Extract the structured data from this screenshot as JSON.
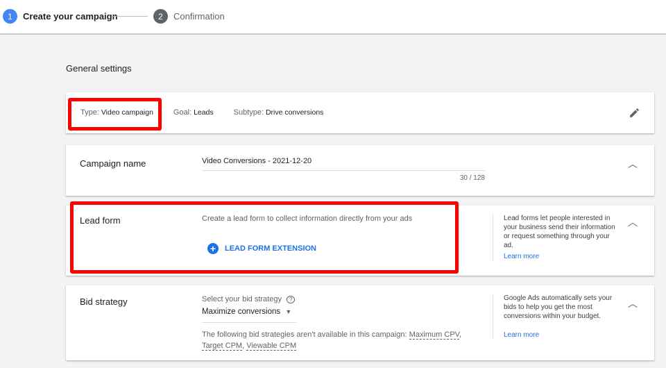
{
  "stepper": {
    "steps": [
      {
        "num": "1",
        "label": "Create your campaign",
        "active": true
      },
      {
        "num": "2",
        "label": "Confirmation",
        "active": false
      }
    ]
  },
  "section_title": "General settings",
  "summary": {
    "type_label": "Type:",
    "type_value": "Video campaign",
    "goal_label": "Goal:",
    "goal_value": "Leads",
    "subtype_label": "Subtype:",
    "subtype_value": "Drive conversions",
    "edit_icon": "pencil-icon"
  },
  "campaign_name": {
    "label": "Campaign name",
    "value": "Video Conversions - 2021-12-20",
    "counter": "30 / 128"
  },
  "lead_form": {
    "label": "Lead form",
    "description": "Create a lead form to collect information directly from your ads",
    "button": "LEAD FORM EXTENSION",
    "info": "Lead forms let people interested in your business send their information or request something through your ad.",
    "learn_more": "Learn more"
  },
  "bid_strategy": {
    "label": "Bid strategy",
    "select_label": "Select your bid strategy",
    "selected": "Maximize conversions",
    "note_prefix": "The following bid strategies aren't available in this campaign:",
    "unavailable": [
      "Maximum CPV",
      "Target CPM",
      "Viewable CPM"
    ],
    "info": "Google Ads automatically sets your bids to help you get the most conversions within your budget.",
    "learn_more": "Learn more"
  },
  "colors": {
    "accent": "#1a73e8",
    "highlight": "#ff0000",
    "background": "#f1f3f4"
  }
}
